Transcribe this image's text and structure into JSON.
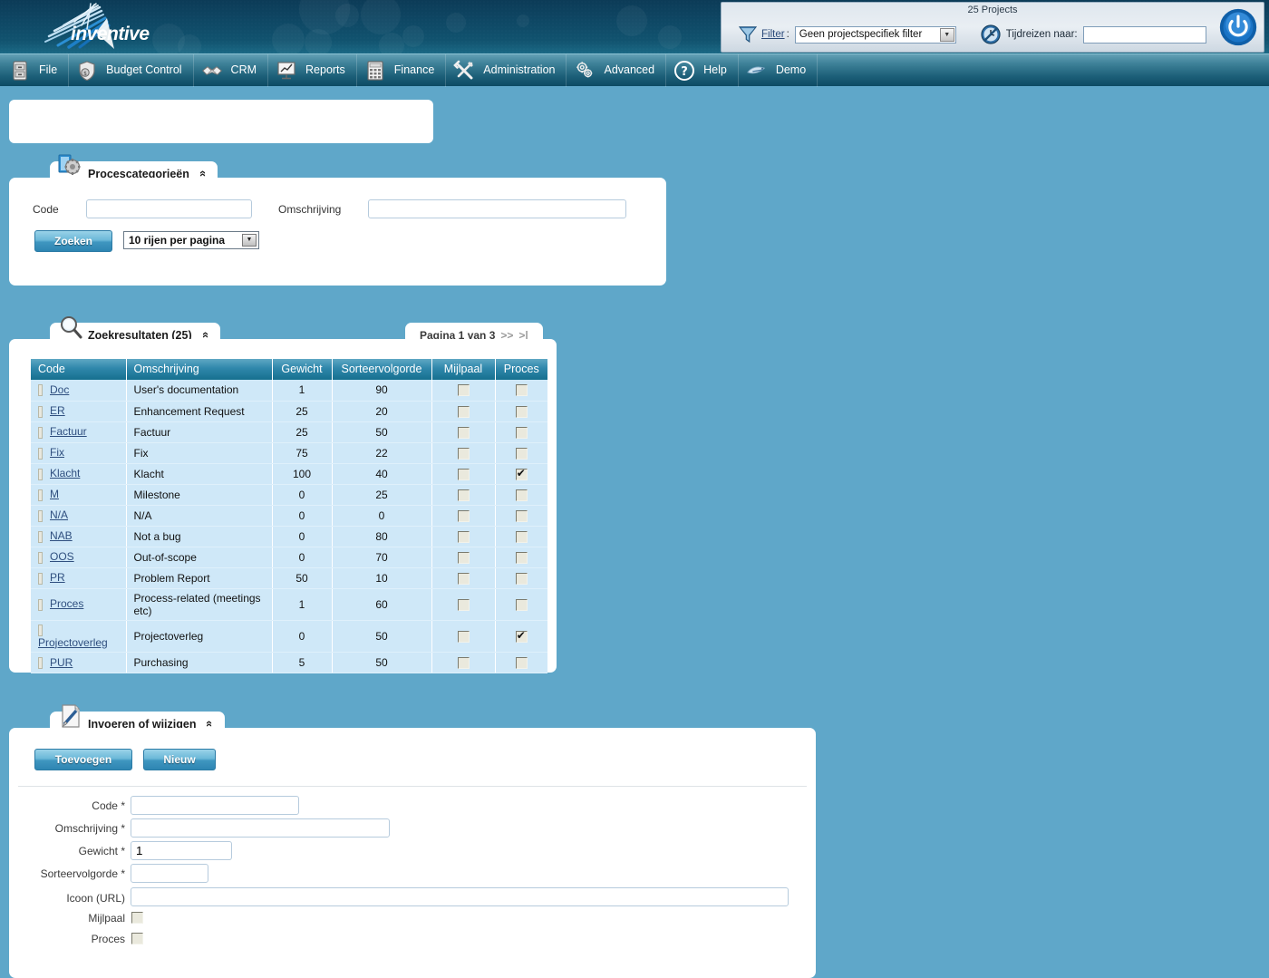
{
  "banner": {
    "logo_word": "inventive"
  },
  "top_panel": {
    "title": "25 Projects",
    "filter_label": "Filter",
    "filter_colon": ":",
    "filter_value": "Geen projectspecifiek filter",
    "timetravel_label": "Tijdreizen naar:",
    "timetravel_value": "",
    "icons": {
      "funnel": "funnel-icon",
      "clock": "clock-no-icon",
      "power": "power-icon"
    }
  },
  "menu": {
    "items": [
      {
        "label": "File",
        "icon": "cabinet-icon"
      },
      {
        "label": "Budget Control",
        "icon": "money-shield-icon"
      },
      {
        "label": "CRM",
        "icon": "handshake-icon"
      },
      {
        "label": "Reports",
        "icon": "presentation-chart-icon"
      },
      {
        "label": "Finance",
        "icon": "calculator-icon"
      },
      {
        "label": "Administration",
        "icon": "tools-icon"
      },
      {
        "label": "Advanced",
        "icon": "gears-icon"
      },
      {
        "label": "Help",
        "icon": "question-circle-icon"
      },
      {
        "label": "Demo",
        "icon": "bird-icon"
      }
    ]
  },
  "search_panel": {
    "tab_title": "Procescategorieën",
    "tab_icon": "book-gear-icon",
    "collapse_glyph": "«",
    "code_label": "Code",
    "code_value": "",
    "omschrijving_label": "Omschrijving",
    "omschrijving_value": "",
    "search_button": "Zoeken",
    "rows_per_page": "10 rijen per pagina",
    "dropdown_glyph": "▼"
  },
  "results_panel": {
    "tab_title": "Zoekresultaten (25)",
    "tab_icon": "magnifier-icon",
    "collapse_glyph": "«",
    "pager_text": "Pagina 1 van 3",
    "pager_next": ">>",
    "pager_last": ">|",
    "columns": [
      "Code",
      "Omschrijving",
      "Gewicht",
      "Sorteervolgorde",
      "Mijlpaal",
      "Proces"
    ],
    "rows": [
      {
        "code": "Doc",
        "omschrijving": "User's documentation",
        "gewicht": "1",
        "sorteervolgorde": "90",
        "mijlpaal": false,
        "proces": false
      },
      {
        "code": "ER",
        "omschrijving": "Enhancement Request",
        "gewicht": "25",
        "sorteervolgorde": "20",
        "mijlpaal": false,
        "proces": false
      },
      {
        "code": "Factuur",
        "omschrijving": "Factuur",
        "gewicht": "25",
        "sorteervolgorde": "50",
        "mijlpaal": false,
        "proces": false
      },
      {
        "code": "Fix",
        "omschrijving": "Fix",
        "gewicht": "75",
        "sorteervolgorde": "22",
        "mijlpaal": false,
        "proces": false
      },
      {
        "code": "Klacht",
        "omschrijving": "Klacht",
        "gewicht": "100",
        "sorteervolgorde": "40",
        "mijlpaal": false,
        "proces": true
      },
      {
        "code": "M",
        "omschrijving": "Milestone",
        "gewicht": "0",
        "sorteervolgorde": "25",
        "mijlpaal": false,
        "proces": false
      },
      {
        "code": "N/A",
        "omschrijving": "N/A",
        "gewicht": "0",
        "sorteervolgorde": "0",
        "mijlpaal": false,
        "proces": false
      },
      {
        "code": "NAB",
        "omschrijving": "Not a bug",
        "gewicht": "0",
        "sorteervolgorde": "80",
        "mijlpaal": false,
        "proces": false
      },
      {
        "code": "OOS",
        "omschrijving": "Out-of-scope",
        "gewicht": "0",
        "sorteervolgorde": "70",
        "mijlpaal": false,
        "proces": false
      },
      {
        "code": "PR",
        "omschrijving": "Problem Report",
        "gewicht": "50",
        "sorteervolgorde": "10",
        "mijlpaal": false,
        "proces": false
      },
      {
        "code": "Proces",
        "omschrijving": "Process-related (meetings etc)",
        "gewicht": "1",
        "sorteervolgorde": "60",
        "mijlpaal": false,
        "proces": false
      },
      {
        "code": "Projectoverleg",
        "omschrijving": "Projectoverleg",
        "gewicht": "0",
        "sorteervolgorde": "50",
        "mijlpaal": false,
        "proces": true
      },
      {
        "code": "PUR",
        "omschrijving": "Purchasing",
        "gewicht": "5",
        "sorteervolgorde": "50",
        "mijlpaal": false,
        "proces": false
      }
    ]
  },
  "edit_panel": {
    "tab_title": "Invoeren of wijzigen",
    "tab_icon": "pencil-note-icon",
    "collapse_glyph": "«",
    "add_button": "Toevoegen",
    "new_button": "Nieuw",
    "fields": {
      "code_label": "Code *",
      "code_value": "",
      "omschrijving_label": "Omschrijving *",
      "omschrijving_value": "",
      "gewicht_label": "Gewicht *",
      "gewicht_value": "1",
      "sorteervolgorde_label": "Sorteervolgorde *",
      "sorteervolgorde_value": "",
      "icoon_label": "Icoon (URL)",
      "icoon_value": "",
      "mijlpaal_label": "Mijlpaal",
      "mijlpaal_checked": false,
      "proces_label": "Proces",
      "proces_checked": false
    }
  },
  "colors": {
    "page_background": "#5fa7c9",
    "banner_dark": "#0c3b57",
    "menu_teal": "#1d6079",
    "grid_header": "#2f87ab",
    "grid_row": "#cfe8f8",
    "link": "#2f4f7f"
  }
}
